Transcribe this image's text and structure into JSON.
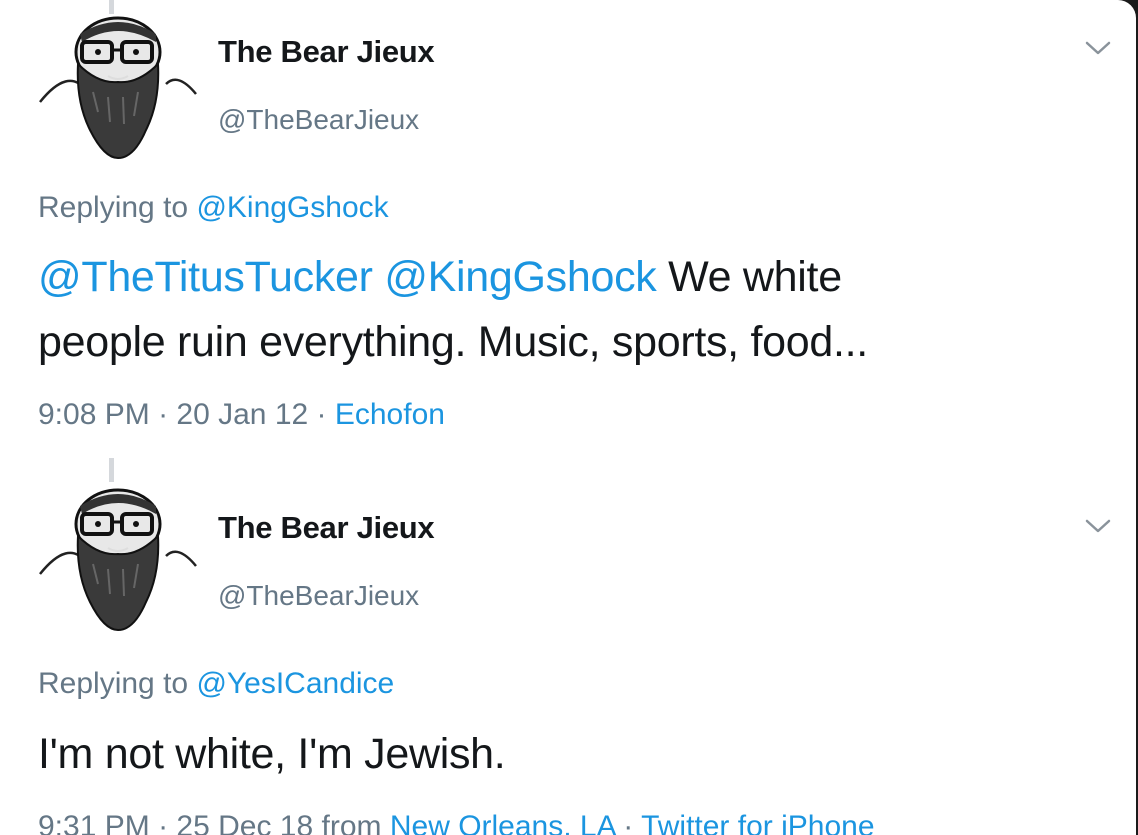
{
  "tweets": [
    {
      "display_name": "The Bear Jieux",
      "handle": "@TheBearJieux",
      "replying_prefix": "Replying to ",
      "replying_to": "@KingGshock",
      "text_mention_1": "@TheTitusTucker",
      "text_mention_2": "@KingGshock",
      "text_rest_line1": " We white",
      "text_line2": "people ruin everything. Music, sports, food...",
      "time": "9:08 PM",
      "sep1": " · ",
      "date": "20 Jan 12",
      "sep2": " · ",
      "source": "Echofon"
    },
    {
      "display_name": "The Bear Jieux",
      "handle": "@TheBearJieux",
      "replying_prefix": "Replying to ",
      "replying_to": "@YesICandice",
      "text": "I'm not white, I'm Jewish.",
      "time": "9:31 PM",
      "sep1": " · ",
      "date": "25 Dec 18",
      "from_prefix": " from ",
      "location": "New Orleans, LA",
      "sep2": " · ",
      "source": "Twitter for iPhone"
    }
  ],
  "icons": {
    "avatar": "bearded-man-avatar-icon",
    "menu": "chevron-down-icon"
  },
  "colors": {
    "text": "#14171a",
    "secondary": "#657786",
    "link": "#1b95e0"
  }
}
